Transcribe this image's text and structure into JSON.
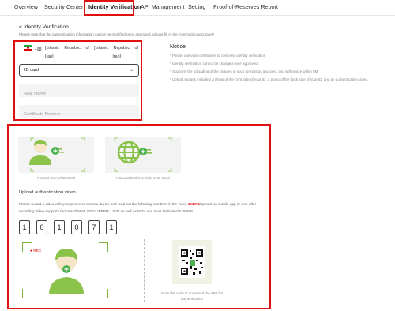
{
  "nav": {
    "tabs": [
      {
        "label": "Overview"
      },
      {
        "label": "Security Center"
      },
      {
        "label": "Identity Verification"
      },
      {
        "label": "API Management"
      },
      {
        "label": "Setting"
      },
      {
        "label": "Proof-of-Reserves Report"
      }
    ],
    "active_tab": "Identity Verification"
  },
  "page": {
    "back_label": "< Identity Verification",
    "note": "Please note that the authentication information cannot be modified once approved, please fill in the information accurately"
  },
  "form": {
    "country": {
      "dial_code": "+98",
      "words_row1": [
        "[Islamic",
        "Republic",
        "of",
        "[Islamic",
        "Republic",
        "of"
      ],
      "words_row2": [
        "Iran]",
        "Iran]"
      ]
    },
    "document_type": "ID card",
    "real_name_placeholder": "Real Name",
    "certificate_placeholder": "Certificate Number"
  },
  "notice": {
    "title": "Notice",
    "lines": [
      "* Please use valid certificates to complete identity verification",
      "* Identify verification cannot be changed once approved.",
      "* Supports the uploading of the pictures in such formats as jpg, jpeg, png with a size within 8M",
      "* Upload images including a photo of the front side of your ID, a photo of the back side of your ID, and an authentication video."
    ]
  },
  "uploads": {
    "portrait_caption": "Portrait Side of ID Card",
    "emblem_caption": "National Emblem Side of ID Card"
  },
  "video": {
    "title": "Upload authentication video",
    "desc_before": "Please record a video with your phone or camera device and read out the following numbers in the video.",
    "code": "101071",
    "desc_after": "Upload via mobile app or web after recording.Video supports formats of MP4, OGG, WEBM，3GP as well as MOV and must be limited to 50MB",
    "digits": [
      "1",
      "0",
      "1",
      "0",
      "7",
      "1"
    ],
    "rec_label": "● REC",
    "qr_caption": "Scan the code to download the APP for authentication"
  },
  "colors": {
    "accent": "#4caf50",
    "highlight": "#e01010",
    "avatar_green": "#8bc34a"
  }
}
